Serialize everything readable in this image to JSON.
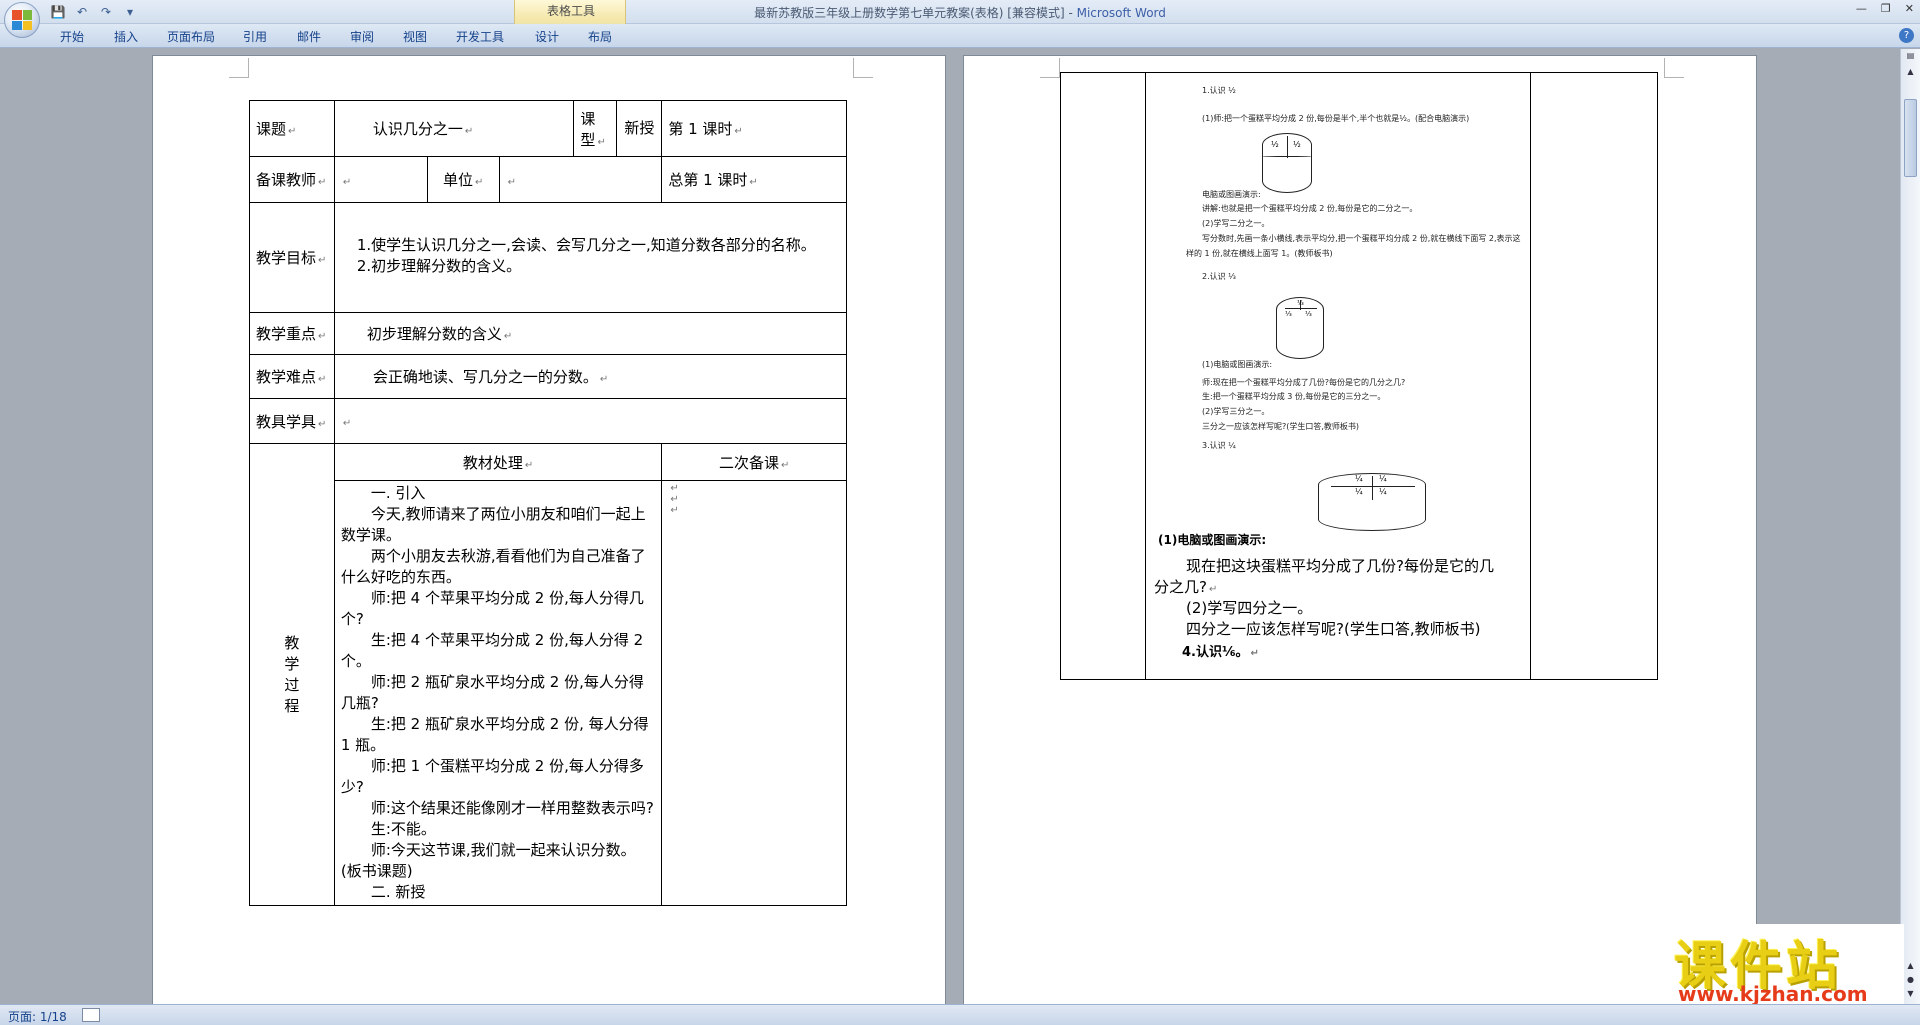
{
  "window": {
    "title": "最新苏教版三年级上册数学第七单元教案(表格) [兼容模式] - ",
    "app_name": "Microsoft Word",
    "context_tab_group": "表格工具"
  },
  "ribbon": {
    "tabs": [
      "开始",
      "插入",
      "页面布局",
      "引用",
      "邮件",
      "审阅",
      "视图",
      "开发工具",
      "设计",
      "布局"
    ]
  },
  "status": {
    "page": "页面: 1/18"
  },
  "left_page": {
    "row1": {
      "label_topic": "课题",
      "topic": "认识几分之一",
      "label_type": "课型",
      "type": "新授",
      "period": "第 1 课时"
    },
    "row2": {
      "label_teacher": "备课教师",
      "label_unit": "单位",
      "total": "总第 1 课时"
    },
    "row3": {
      "label": "教学目标",
      "items": [
        "1.使学生认识几分之一,会读、会写几分之一,知道分数各部分的名称。",
        "2.初步理解分数的含义。"
      ]
    },
    "row4": {
      "label": "教学重点",
      "value": "初步理解分数的含义"
    },
    "row5": {
      "label": "教学难点",
      "value": "会正确地读、写几分之一的分数。"
    },
    "row6": {
      "label": "教具学具",
      "value": ""
    },
    "row7": {
      "label_material": "教材处理",
      "label_second": "二次备课"
    },
    "process": {
      "label_chars": [
        "教",
        "学",
        "过",
        "程"
      ],
      "lines": [
        "一. 引入",
        "今天,教师请来了两位小朋友和咱们一起上数学课。",
        "两个小朋友去秋游,看看他们为自己准备了什么好吃的东西。",
        "师:把 4 个苹果平均分成 2 份,每人分得几个?",
        "生:把 4 个苹果平均分成 2 份,每人分得 2 个。",
        "师:把 2 瓶矿泉水平均分成 2 份,每人分得几瓶?",
        "生:把 2 瓶矿泉水平均分成 2 份, 每人分得 1 瓶。",
        "师:把 1 个蛋糕平均分成 2 份,每人分得多少?",
        "师:这个结果还能像刚才一样用整数表示吗?",
        "生:不能。",
        "师:今天这节课,我们就一起来认识分数。(板书课题)",
        "二. 新授"
      ]
    }
  },
  "right_page": {
    "s1_title": "1.认识",
    "s1_line1": "(1)师:把一个蛋糕平均分成 2 份,每份是半个,半个也就是",
    "s1_line1_tail": "。(配合电脑演示)",
    "s1_demo": "电脑或图画演示:",
    "s1_explain": "讲解:也就是把一个蛋糕平均分成 2 份,每份是它的二分之一。",
    "s1_write": "(2)学写二分之一。",
    "s1_write_detail1": "写分数时,先画一条小横线,表示平均分,把一个蛋糕平均分成 2 份,就在横线下面写 2,表示这",
    "s1_write_detail2": "样的 1 份,就在横线上面写 1。(教师板书)",
    "s2_title": "2.认识",
    "s2_demo": "(1)电脑或图画演示:",
    "s2_q": "师:现在把一个蛋糕平均分成了几份?每份是它的几分之几?",
    "s2_a": "生:把一个蛋糕平均分成 3 份,每份是它的三分之一。",
    "s2_write": "(2)学写三分之一。",
    "s2_how": "三分之一应该怎样写呢?(学生口答,教师板书)",
    "s3_title": "3.认识",
    "s3_demo": "(1)电脑或图画演示:",
    "s3_q": "现在把这块蛋糕平均分成了几份?每份是它的几分之几?",
    "s3_write": "(2)学写四分之一。",
    "s3_how": "四分之一应该怎样写呢?(学生口答,教师板书)",
    "s4_title": "4.认识"
  },
  "watermark": {
    "cn": "课件站",
    "url": "www.kjzhan.com"
  }
}
